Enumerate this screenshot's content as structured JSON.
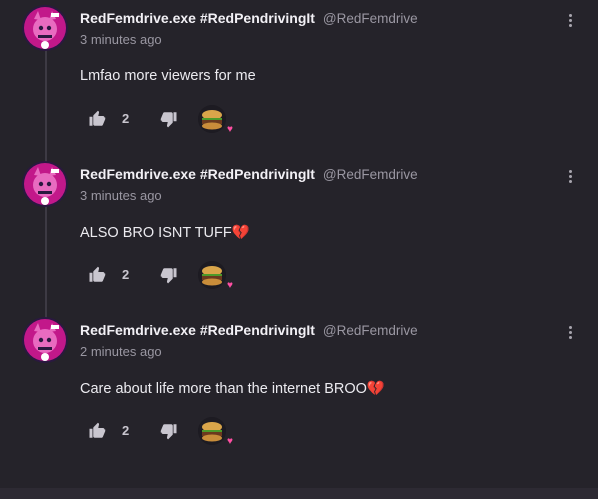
{
  "comments": [
    {
      "author": "RedFemdrive.exe #RedPendrivingIt",
      "handle": "@RedFemdrive",
      "time": "3 minutes ago",
      "text": "Lmfao more viewers for me",
      "likes": "2"
    },
    {
      "author": "RedFemdrive.exe #RedPendrivingIt",
      "handle": "@RedFemdrive",
      "time": "3 minutes ago",
      "text": "ALSO BRO ISNT TUFF💔",
      "likes": "2"
    },
    {
      "author": "RedFemdrive.exe #RedPendrivingIt",
      "handle": "@RedFemdrive",
      "time": "2 minutes ago",
      "text": "Care about life more than the internet BROO💔",
      "likes": "2"
    }
  ],
  "icons": {
    "more": "more-vertical-icon",
    "like": "thumbs-up-icon",
    "dislike": "thumbs-down-icon",
    "heart": "heart-icon"
  },
  "colors": {
    "background": "#25232a",
    "heart": "#ff4fa3",
    "avatar_magenta": "#c2188a"
  }
}
